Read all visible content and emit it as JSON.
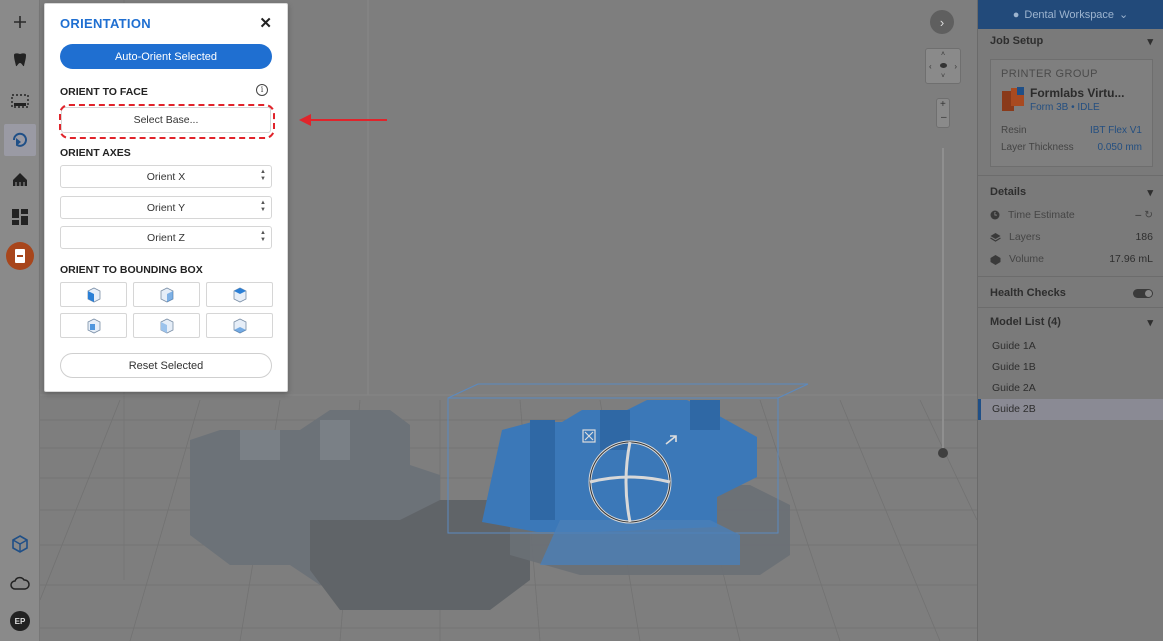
{
  "orientation_panel": {
    "title": "ORIENTATION",
    "close_glyph": "✕",
    "auto_orient_label": "Auto-Orient Selected",
    "orient_to_face_title": "ORIENT TO FACE",
    "select_base_label": "Select Base...",
    "orient_axes_title": "ORIENT AXES",
    "axes": [
      "Orient X",
      "Orient Y",
      "Orient Z"
    ],
    "bounding_box_title": "ORIENT TO BOUNDING BOX",
    "reset_label": "Reset Selected"
  },
  "right_panel": {
    "workspace_label": "Dental Workspace",
    "job_setup_title": "Job Setup",
    "printer_group_label": "PRINTER GROUP",
    "printer_name": "Formlabs Virtu...",
    "printer_sub": "Form 3B • IDLE",
    "resin_label": "Resin",
    "resin_value": "IBT Flex V1",
    "layer_thickness_label": "Layer Thickness",
    "layer_thickness_value": "0.050 mm",
    "details_title": "Details",
    "time_estimate_label": "Time Estimate",
    "time_estimate_value": "–",
    "layers_label": "Layers",
    "layers_value": "186",
    "volume_label": "Volume",
    "volume_value": "17.96 mL",
    "health_checks_label": "Health Checks",
    "model_list_title": "Model List (4)",
    "models": [
      "Guide 1A",
      "Guide 1B",
      "Guide 2A",
      "Guide 2B"
    ],
    "selected_model": "Guide 2B"
  },
  "user": {
    "initials": "EP"
  },
  "colors": {
    "accent": "#1f6fd1",
    "highlight": "#e0242b",
    "model_blue": "#3b78b8"
  }
}
